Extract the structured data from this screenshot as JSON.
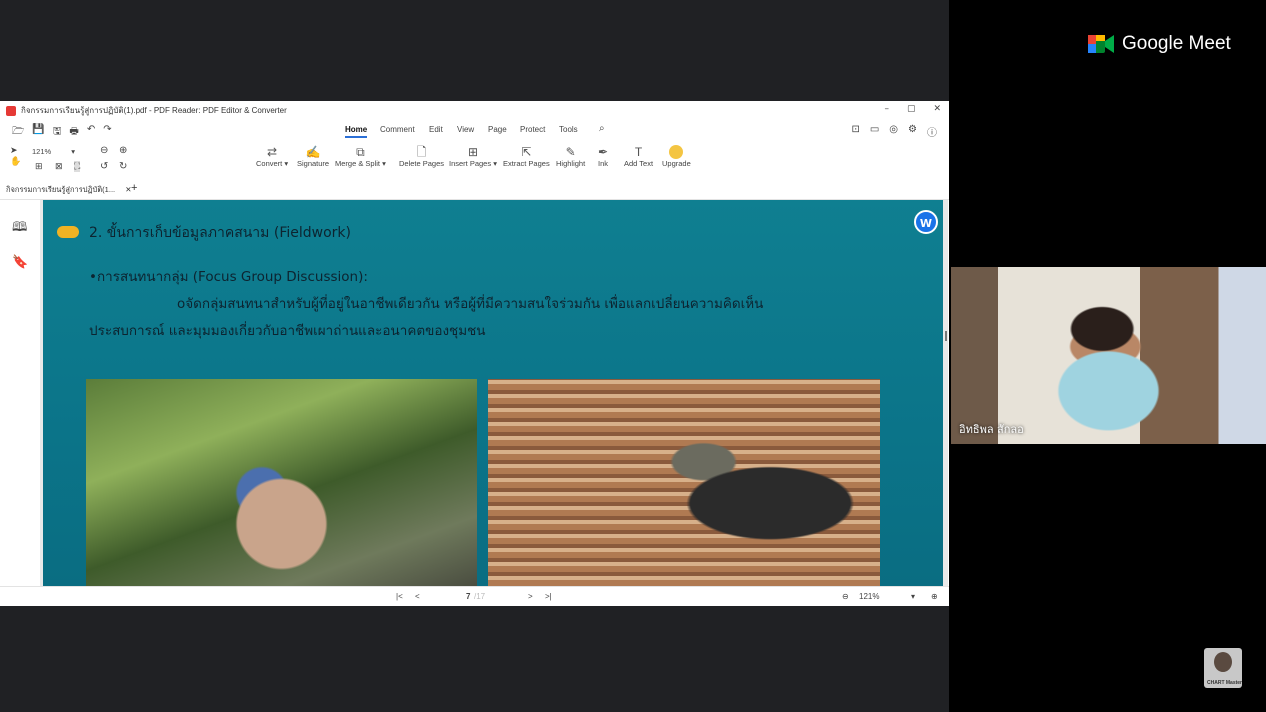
{
  "meet": {
    "brand": "Google Meet"
  },
  "window": {
    "title": "กิจกรรมการเรียนรู้สู่การปฏิบัติ(1).pdf - PDF Reader: PDF Editor & Converter",
    "controls": [
      "–",
      "▢",
      "✕"
    ]
  },
  "menu": {
    "tabs": [
      "Home",
      "Comment",
      "Edit",
      "View",
      "Page",
      "Protect",
      "Tools"
    ],
    "active": "Home"
  },
  "toolbar": {
    "zoom": "121%",
    "tools": [
      {
        "label": "Convert ▾",
        "icon": "convert-icon"
      },
      {
        "label": "Signature",
        "icon": "signature-icon"
      },
      {
        "label": "Merge & Split ▾",
        "icon": "merge-icon"
      },
      {
        "label": "Delete Pages",
        "icon": "delete-pages-icon"
      },
      {
        "label": "Insert Pages ▾",
        "icon": "insert-pages-icon"
      },
      {
        "label": "Extract Pages",
        "icon": "extract-pages-icon"
      },
      {
        "label": "Highlight",
        "icon": "highlight-icon"
      },
      {
        "label": "Ink",
        "icon": "ink-icon"
      },
      {
        "label": "Add Text",
        "icon": "add-text-icon"
      },
      {
        "label": "Upgrade",
        "icon": "upgrade-icon"
      }
    ]
  },
  "doc_tab": {
    "label": "กิจกรรมการเรียนรู้สู่การปฏิบัติ(1...",
    "close": "✕",
    "add": "+"
  },
  "slide": {
    "heading": "2. ขั้นการเก็บข้อมูลภาคสนาม (Fieldwork)",
    "bullet": "•การสนทนากลุ่ม (Focus Group Discussion):",
    "line1": "oจัดกลุ่มสนทนาสำหรับผู้ที่อยู่ในอาชีพเดียวกัน หรือผู้ที่มีความสนใจร่วมกัน เพื่อแลกเปลี่ยนความคิดเห็น",
    "line2": "ประสบการณ์ และมุมมองเกี่ยวกับอาชีพเผาถ่านและอนาคตของชุมชน",
    "badge": "W"
  },
  "pager": {
    "current_page": "7",
    "total": "/17",
    "zoom": "121%"
  },
  "participant": {
    "name": "อิทธิพล สักลอ"
  },
  "selfview": {
    "label": "CHART Master"
  }
}
